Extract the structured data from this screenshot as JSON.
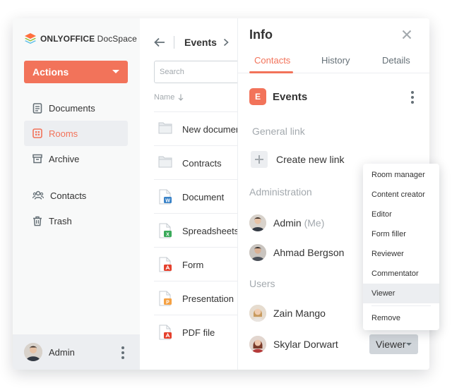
{
  "app": {
    "brand": "ONLYOFFICE",
    "product": "DocSpace",
    "actions_label": "Actions"
  },
  "sidebar": {
    "items": [
      {
        "label": "Documents",
        "icon": "document-icon",
        "active": false
      },
      {
        "label": "Rooms",
        "icon": "rooms-icon",
        "active": true
      },
      {
        "label": "Archive",
        "icon": "archive-icon",
        "active": false
      },
      {
        "label": "Contacts",
        "icon": "contacts-icon",
        "active": false
      },
      {
        "label": "Trash",
        "icon": "trash-icon",
        "active": false
      }
    ],
    "footer": {
      "user_name": "Admin"
    }
  },
  "files": {
    "breadcrumb_title": "Events",
    "search_placeholder": "Search",
    "column_header": "Name",
    "rows": [
      {
        "name": "New document",
        "type": "folder"
      },
      {
        "name": "Contracts",
        "type": "folder"
      },
      {
        "name": "Document",
        "type": "docx"
      },
      {
        "name": "Spreadsheets",
        "type": "xlsx"
      },
      {
        "name": "Form",
        "type": "pdf-form"
      },
      {
        "name": "Presentation",
        "type": "pptx"
      },
      {
        "name": "PDF file",
        "type": "pdf"
      }
    ]
  },
  "info": {
    "title": "Info",
    "tabs": [
      {
        "label": "Contacts",
        "active": true
      },
      {
        "label": "History",
        "active": false
      },
      {
        "label": "Details",
        "active": false
      }
    ],
    "room": {
      "badge": "E",
      "name": "Events"
    },
    "general_link_label": "General link",
    "create_link_label": "Create new link",
    "administration_label": "Administration",
    "users_label": "Users",
    "admins": [
      {
        "name": "Admin",
        "suffix": "(Me)"
      },
      {
        "name": "Ahmad Bergson",
        "suffix": ""
      }
    ],
    "users": [
      {
        "name": "Zain Mango"
      },
      {
        "name": "Skylar Dorwart",
        "role": "Viewer"
      }
    ]
  },
  "role_menu": {
    "options": [
      "Room manager",
      "Content creator",
      "Editor",
      "Form filler",
      "Reviewer",
      "Commentator",
      "Viewer"
    ],
    "selected": "Viewer",
    "remove_label": "Remove"
  },
  "colors": {
    "accent": "#F2735A",
    "sidebar_bg": "#F8F9F9",
    "muted_text": "#A3A9AE",
    "divider": "#ECEEF1"
  }
}
